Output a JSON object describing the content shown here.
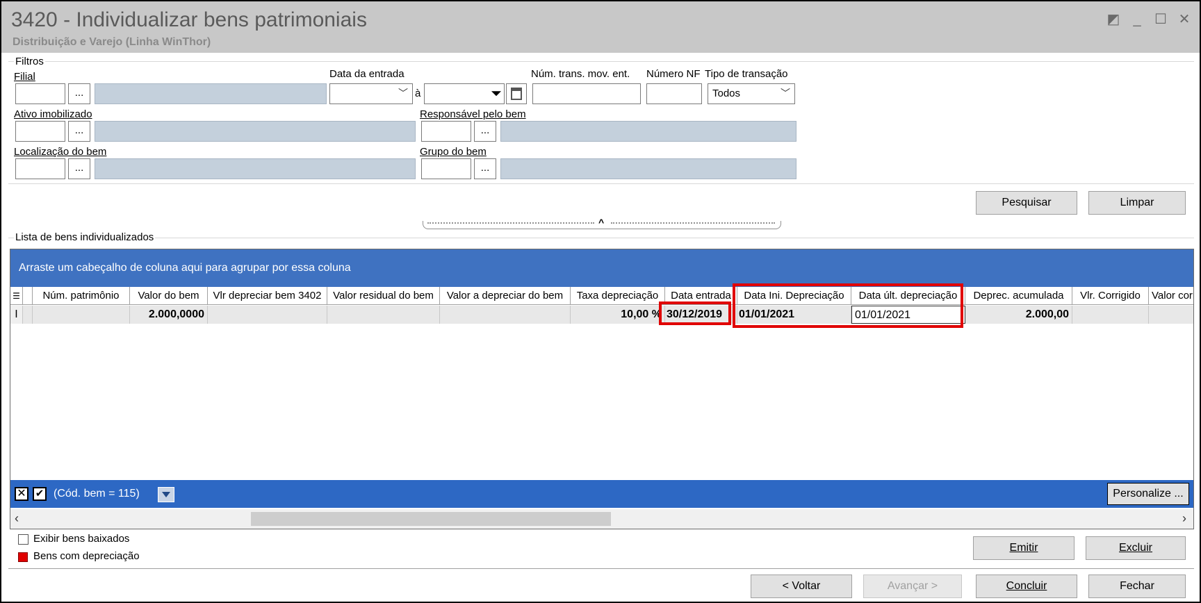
{
  "window": {
    "title": "3420 - Individualizar bens patrimoniais",
    "subtitle": "Distribuição e Varejo (Linha WinThor)",
    "controls": {
      "restore": "◩",
      "minimize": "_",
      "maximize": "☐",
      "close": "✕"
    }
  },
  "filters": {
    "group_label": "Filtros",
    "filial_label": "Filial",
    "data_entrada_label": "Data da entrada",
    "date_separator": "à",
    "num_trans_label": "Núm. trans. mov. ent.",
    "numero_nf_label": "Número NF",
    "tipo_transacao_label": "Tipo de transação",
    "tipo_transacao_value": "Todos",
    "ativo_label": "Ativo imobilizado",
    "responsavel_label": "Responsável pelo bem",
    "localizacao_label": "Localização do bem",
    "grupo_label": "Grupo do bem",
    "lookup_button": "..."
  },
  "actions": {
    "pesquisar": "Pesquisar",
    "limpar": "Limpar"
  },
  "list": {
    "group_label": "Lista de bens individualizados",
    "group_panel_hint": "Arraste um cabeçalho de coluna aqui para agrupar por essa coluna",
    "columns": [
      "Núm. patrimônio",
      "Valor do bem",
      "Vlr depreciar bem 3402",
      "Valor residual do bem",
      "Valor a depreciar do bem",
      "Taxa depreciação",
      "Data entrada",
      "Data Ini. Depreciação",
      "Data últ. depreciação",
      "Deprec. acumulada",
      "Vlr. Corrigido",
      "Valor corrigido"
    ],
    "row": {
      "indicator": "I",
      "num_patrimonio": "",
      "valor_bem": "2.000,0000",
      "vlr_depreciar_3402": "",
      "valor_residual": "",
      "valor_a_depreciar": "",
      "taxa_depreciacao": "10,00 %",
      "data_entrada": "30/12/2019",
      "data_ini_depreciacao": "01/01/2021",
      "data_ult_depreciacao": "01/01/2021",
      "deprec_acumulada": "2.000,00",
      "vlr_corrigido": "",
      "valor_corrigido": ""
    },
    "filter_text": "(Cód. bem = 115)",
    "personalize": "Personalize ..."
  },
  "legend": {
    "exibir_baixados": "Exibir bens baixados",
    "bens_depreciacao": "Bens com depreciação",
    "color_depreciacao": "#e00000"
  },
  "bottom_buttons": {
    "emitir": "Emitir",
    "excluir": "Excluir",
    "voltar": "< Voltar",
    "avancar": "Avançar >",
    "concluir": "Concluir",
    "fechar": "Fechar"
  },
  "colors": {
    "group_panel": "#3f72c1",
    "filter_bar": "#2d68c4",
    "highlight": "#e00000",
    "readonly_field": "#c4d0dc"
  }
}
